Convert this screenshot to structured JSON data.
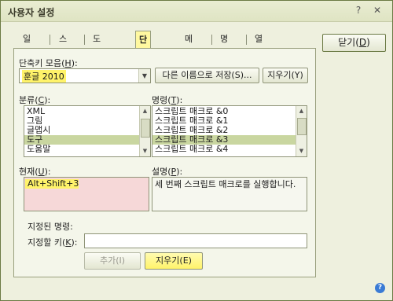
{
  "window": {
    "title": "사용자 설정",
    "help_glyph": "?",
    "close_glyph": "✕"
  },
  "tabs": [
    {
      "label": "일반"
    },
    {
      "label": "스킨"
    },
    {
      "label": "도구 상자"
    },
    {
      "label": "단축키",
      "active": true
    },
    {
      "label": "메뉴"
    },
    {
      "label": "명령"
    },
    {
      "label": "열림 상자"
    }
  ],
  "close_button": {
    "label": "닫기",
    "mnemonic": "D"
  },
  "shortcut_set": {
    "label": "단축키 모음",
    "mnemonic": "H",
    "value": "훈글 2010",
    "save_as_label": "다른 이름으로 저장(S)...",
    "delete_label": "지우기(Y)"
  },
  "category": {
    "label": "분류",
    "mnemonic": "C",
    "items": [
      "XML",
      "그림",
      "글맵시",
      "도구",
      "도움말"
    ],
    "selected_index": 3
  },
  "command": {
    "label": "명령",
    "mnemonic": "T",
    "items": [
      "스크립트 매크로 &0",
      "스크립트 매크로 &1",
      "스크립트 매크로 &2",
      "스크립트 매크로 &3",
      "스크립트 매크로 &4"
    ],
    "selected_index": 3
  },
  "current": {
    "label": "현재",
    "mnemonic": "U",
    "value": "Alt+Shift+3"
  },
  "description": {
    "label": "설명",
    "mnemonic": "P",
    "text": "세 번째 스크립트 매크로를 실행합니다."
  },
  "assigned": {
    "label": "지정된 명령:"
  },
  "key_to_assign": {
    "label": "지정할 키",
    "mnemonic": "K",
    "value": ""
  },
  "add_button": {
    "label": "추가(I)"
  },
  "remove_button": {
    "label": "지우기(E)"
  },
  "help_icon": "question-icon"
}
